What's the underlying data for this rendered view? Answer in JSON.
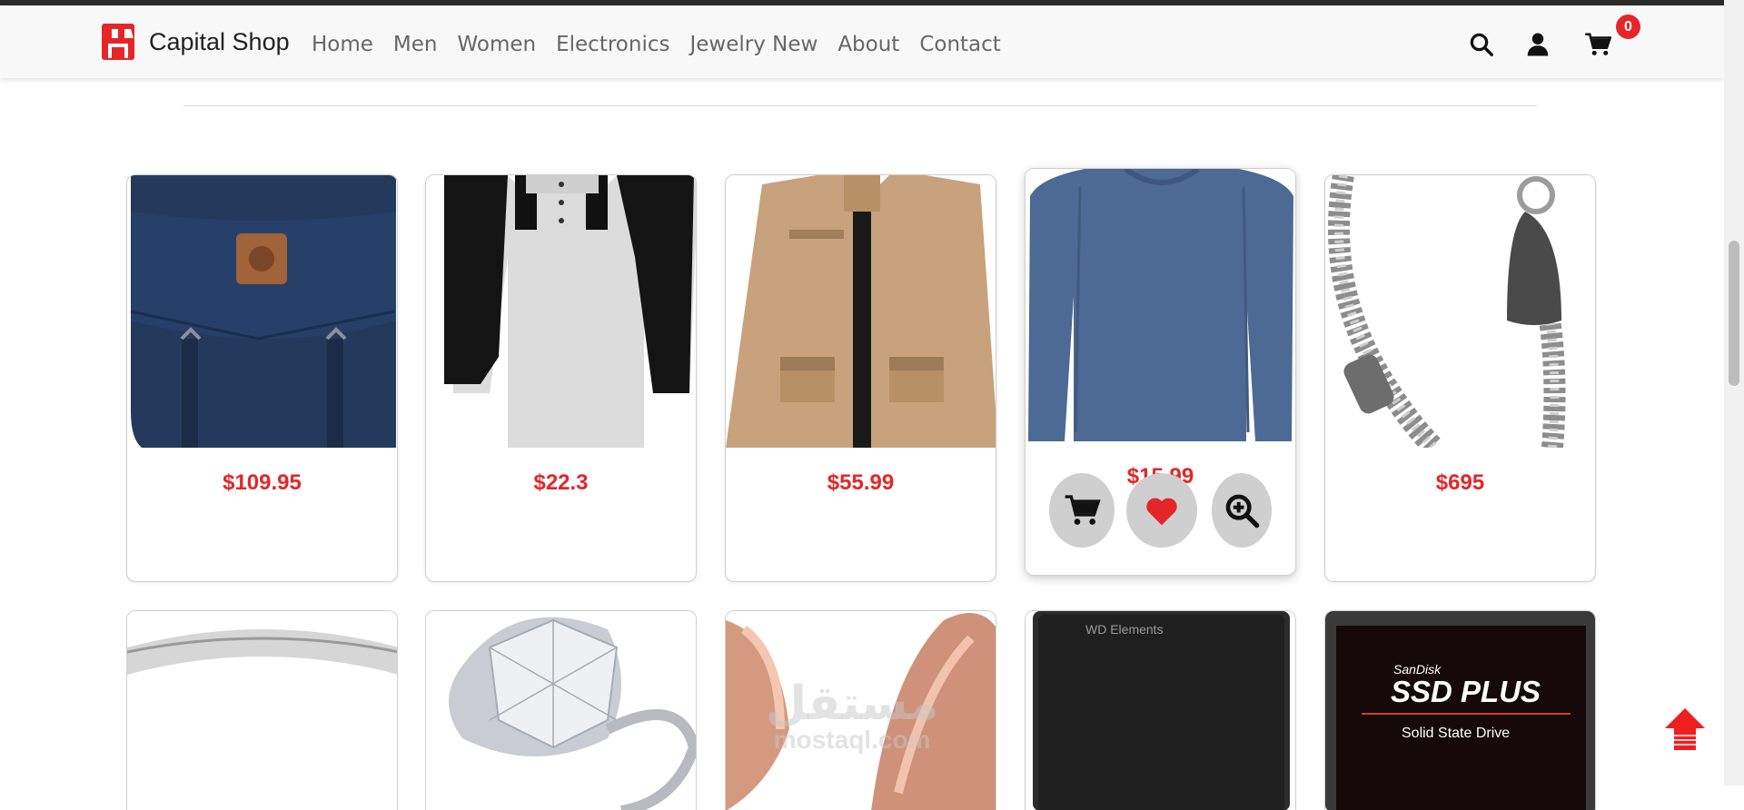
{
  "brand": {
    "name": "Capital Shop",
    "icon": "store-icon"
  },
  "nav": {
    "items": [
      "Home",
      "Men",
      "Women",
      "Electronics",
      "Jewelry New",
      "About",
      "Contact"
    ],
    "icons": [
      "search-icon",
      "user-icon",
      "cart-icon"
    ],
    "cart_count": "0"
  },
  "products": [
    {
      "price": "$109.95",
      "image": "navy backpack"
    },
    {
      "price": "$22.3",
      "image": "grey raglan t-shirt"
    },
    {
      "price": "$55.99",
      "image": "khaki jacket"
    },
    {
      "price": "$15.99",
      "image": "blue long sleeve shirt"
    },
    {
      "price": "$695",
      "image": "silver dragon bracelet"
    }
  ],
  "hover_actions": [
    "cart-icon",
    "heart-icon",
    "zoom-in-icon"
  ],
  "products_row2": [
    {
      "image": "silver ring"
    },
    {
      "image": "diamond ring"
    },
    {
      "image": "rose gold rings"
    },
    {
      "image": "WD Elements hard drive",
      "label": "WD Elements"
    },
    {
      "image": "SanDisk SSD PLUS",
      "brand": "SanDisk",
      "title": "SSD PLUS",
      "subtitle": "Solid State Drive"
    }
  ],
  "watermark": {
    "arabic": "مستقل",
    "latin": "mostaql.com"
  },
  "colors": {
    "accent": "#e52629",
    "text": "#666666"
  }
}
